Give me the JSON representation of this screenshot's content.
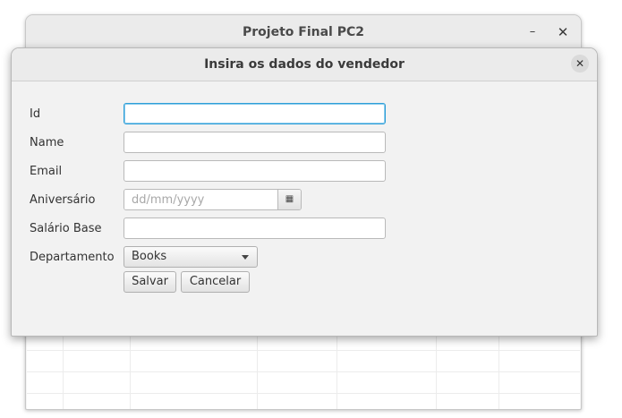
{
  "main_window": {
    "title": "Projeto Final PC2",
    "minimize_glyph": "–",
    "close_glyph": "✕"
  },
  "dialog": {
    "title": "Insira os dados do vendedor",
    "close_glyph": "✕",
    "labels": {
      "id": "Id",
      "name": "Name",
      "email": "Email",
      "birthday": "Aniversário",
      "base_salary": "Salário Base",
      "department": "Departamento"
    },
    "fields": {
      "id_value": "",
      "name_value": "",
      "email_value": "",
      "birthday_placeholder": "dd/mm/yyyy",
      "base_salary_value": ""
    },
    "department_selected": "Books",
    "buttons": {
      "save": "Salvar",
      "cancel": "Cancelar"
    },
    "icons": {
      "calendar": "calendar-icon",
      "dropdown": "chevron-down-icon",
      "close": "close-icon"
    }
  },
  "colors": {
    "focus_border": "#2e9fd8",
    "window_bg": "#f2f2f2",
    "titlebar_bg": "#ebebeb"
  }
}
